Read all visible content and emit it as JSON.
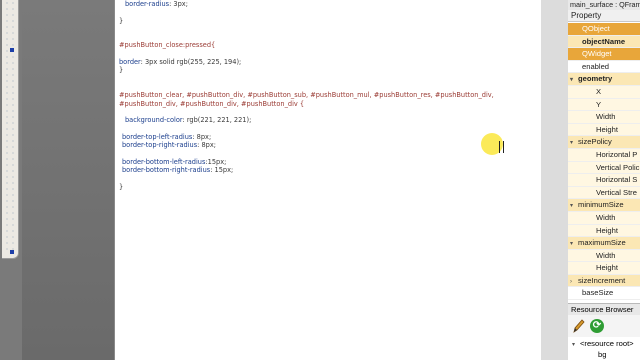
{
  "editor": {
    "lines": [
      {
        "indent": 2,
        "parts": [
          {
            "t": "border-radius",
            "k": "prop"
          },
          {
            "t": ": 3px;",
            "k": "val"
          }
        ]
      },
      {
        "indent": 0,
        "parts": []
      },
      {
        "indent": 0,
        "parts": [
          {
            "t": "}",
            "k": "val"
          }
        ]
      },
      {
        "indent": 0,
        "parts": []
      },
      {
        "indent": 0,
        "parts": []
      },
      {
        "indent": 0,
        "parts": [
          {
            "t": "#pushButton_close:pressed{",
            "k": "sel"
          }
        ]
      },
      {
        "indent": 0,
        "parts": []
      },
      {
        "indent": 0,
        "parts": [
          {
            "t": "border",
            "k": "prop"
          },
          {
            "t": ": 3px solid rgb(255, 225, 194);",
            "k": "val"
          }
        ]
      },
      {
        "indent": 0,
        "parts": [
          {
            "t": "}",
            "k": "val"
          }
        ]
      },
      {
        "indent": 0,
        "parts": []
      },
      {
        "indent": 0,
        "parts": []
      },
      {
        "indent": 0,
        "parts": [
          {
            "t": "#pushButton_clear, #pushButton_div, #pushButton_sub, #pushButton_mul, #pushButton_res, #pushButton_div,",
            "k": "sel"
          }
        ]
      },
      {
        "indent": 0,
        "parts": [
          {
            "t": "#pushButton_div, #pushButton_div, #pushButton_div {",
            "k": "sel"
          }
        ]
      },
      {
        "indent": 0,
        "parts": []
      },
      {
        "indent": 2,
        "parts": [
          {
            "t": "background-color",
            "k": "prop"
          },
          {
            "t": ": rgb(221, 221, 221);",
            "k": "val"
          }
        ]
      },
      {
        "indent": 0,
        "parts": []
      },
      {
        "indent": 1,
        "parts": [
          {
            "t": "border-top-left-radius",
            "k": "prop"
          },
          {
            "t": ": 8px;",
            "k": "val"
          }
        ]
      },
      {
        "indent": 1,
        "parts": [
          {
            "t": "border-top-right-radius",
            "k": "prop"
          },
          {
            "t": ": 8px;",
            "k": "val"
          }
        ]
      },
      {
        "indent": 0,
        "parts": []
      },
      {
        "indent": 1,
        "parts": [
          {
            "t": "border-bottom-left-radius",
            "k": "prop"
          },
          {
            "t": ":15px;",
            "k": "val"
          }
        ]
      },
      {
        "indent": 1,
        "parts": [
          {
            "t": "border-bottom-right-radius",
            "k": "prop"
          },
          {
            "t": ": 15px;",
            "k": "val"
          }
        ]
      },
      {
        "indent": 0,
        "parts": []
      },
      {
        "indent": 0,
        "parts": [
          {
            "t": "}",
            "k": "val"
          }
        ]
      }
    ]
  },
  "property_editor": {
    "title": "main_surface : QFrame",
    "header": "Property",
    "rows": [
      {
        "label": "QObject",
        "type": "cls"
      },
      {
        "label": "objectName",
        "type": "cls-yellow"
      },
      {
        "label": "QWidget",
        "type": "cls"
      },
      {
        "label": "enabled",
        "type": "white"
      },
      {
        "label": "geometry",
        "type": "group bold",
        "arrow": "▾"
      },
      {
        "label": "X",
        "type": "sub"
      },
      {
        "label": "Y",
        "type": "sub"
      },
      {
        "label": "Width",
        "type": "sub"
      },
      {
        "label": "Height",
        "type": "sub"
      },
      {
        "label": "sizePolicy",
        "type": "group",
        "arrow": "▾"
      },
      {
        "label": "Horizontal P",
        "type": "sub"
      },
      {
        "label": "Vertical Polic",
        "type": "sub"
      },
      {
        "label": "Horizontal S",
        "type": "sub"
      },
      {
        "label": "Vertical Stre",
        "type": "sub"
      },
      {
        "label": "minimumSize",
        "type": "group",
        "arrow": "▾"
      },
      {
        "label": "Width",
        "type": "sub"
      },
      {
        "label": "Height",
        "type": "sub"
      },
      {
        "label": "maximumSize",
        "type": "group",
        "arrow": "▾"
      },
      {
        "label": "Width",
        "type": "sub"
      },
      {
        "label": "Height",
        "type": "sub"
      },
      {
        "label": "sizeIncrement",
        "type": "group",
        "arrow": "›"
      },
      {
        "label": "baseSize",
        "type": "white"
      }
    ]
  },
  "resource_browser": {
    "title": "Resource Browser",
    "root_label": "<resource root>",
    "child_label": "bg"
  }
}
